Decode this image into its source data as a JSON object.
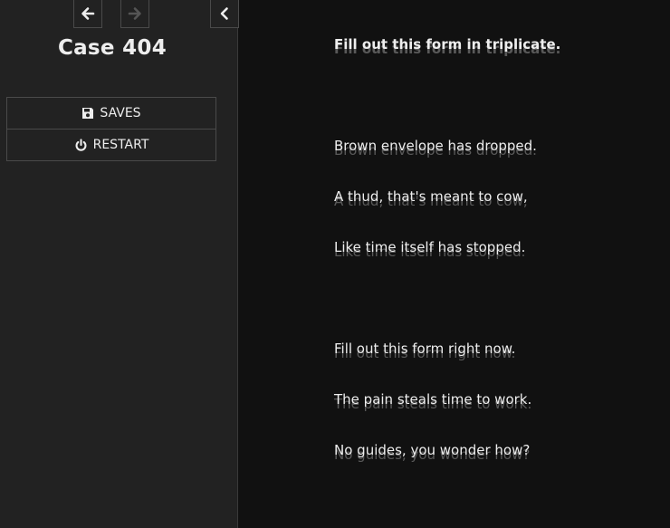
{
  "sidebar": {
    "title": "Case 404",
    "back_icon": "arrow-left-icon",
    "forward_icon": "arrow-right-icon",
    "collapse_icon": "chevron-left-icon",
    "saves_label": "SAVES",
    "restart_label": "RESTART"
  },
  "passage": {
    "lines": [
      "Fill out this form in triplicate.",
      "Brown envelope has dropped.",
      "A thud, that's meant to cow,",
      "Like time itself has stopped.",
      "Fill out this form right now.",
      "The pain steals time to work.",
      "No guides, you wonder how?"
    ]
  },
  "colors": {
    "sidebar_bg": "#222222",
    "main_bg": "#111111",
    "text": "#eeeeee",
    "disabled": "#555555"
  }
}
